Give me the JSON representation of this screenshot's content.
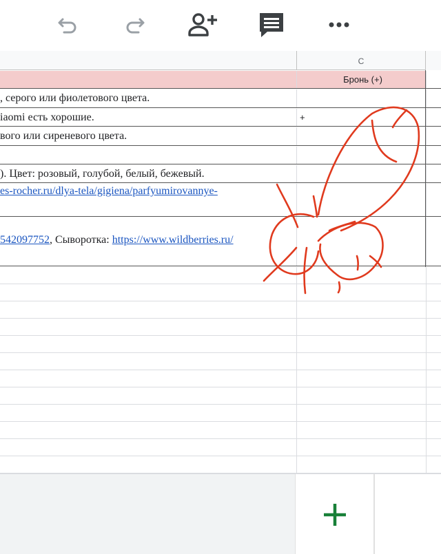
{
  "toolbar": {
    "buttons": [
      {
        "name": "undo-button",
        "icon": "undo-icon"
      },
      {
        "name": "redo-button",
        "icon": "redo-icon"
      },
      {
        "name": "share-button",
        "icon": "add-person-icon"
      },
      {
        "name": "comment-button",
        "icon": "comment-icon"
      },
      {
        "name": "more-button",
        "icon": "more-horizontal-icon"
      }
    ]
  },
  "sheet": {
    "column_c_header": "C",
    "header_row": {
      "a": "",
      "c": "Бронь (+)"
    },
    "rows": [
      {
        "a": ", серого или фиолетового цвета.",
        "c": ""
      },
      {
        "a": "iaomi есть хорошие.",
        "c": "+"
      },
      {
        "a": "вого или сиреневого цвета.",
        "c": ""
      },
      {
        "a": "",
        "c": ""
      },
      {
        "a": "). Цвет: розовый, голубой, белый, бежевый.",
        "c": ""
      },
      {
        "a_link": "es-rocher.ru/dlya-tela/gigiena/parfyumirovannye-",
        "c": ""
      },
      {
        "a_link": "542097752",
        "a_text": ", Сыворотка: ",
        "a_link2": "https://www.wildberries.ru/",
        "c": ""
      }
    ]
  },
  "bottom": {
    "add_sheet_icon": "plus-icon",
    "accent": "#188038"
  },
  "colors": {
    "header_fill": "#f4cccc",
    "link": "#1a55c0",
    "scribble": "#e03a1e"
  }
}
